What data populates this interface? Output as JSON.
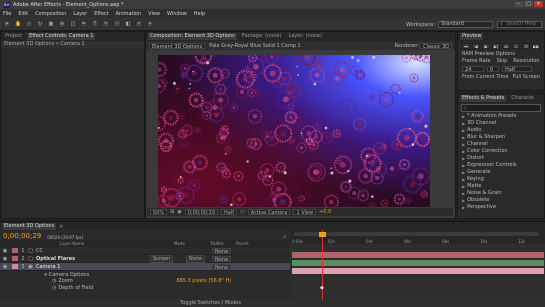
{
  "app": {
    "title": "Adobe After Effects - Element_Options.aep *",
    "logo": "Ae",
    "window_controls": [
      "–",
      "□",
      "✕"
    ]
  },
  "menu": [
    "File",
    "Edit",
    "Composition",
    "Layer",
    "Effect",
    "Animation",
    "View",
    "Window",
    "Help"
  ],
  "toolbar": {
    "tools": [
      "selection-tool-icon",
      "hand-tool-icon",
      "zoom-tool-icon",
      "rotate-tool-icon",
      "camera-tool-icon",
      "pan-behind-icon",
      "rectangle-tool-icon",
      "pen-tool-icon",
      "type-tool-icon",
      "brush-tool-icon",
      "clone-stamp-icon",
      "eraser-icon",
      "roto-brush-icon",
      "puppet-pin-icon"
    ],
    "workspace_label": "Workspace:",
    "workspace_value": "Standard",
    "search_placeholder": "Search Help"
  },
  "project": {
    "tabs": [
      "Project",
      "Effect Controls: Camera 1"
    ],
    "breadcrumb": "Element 3D Options • Camera 1"
  },
  "composition": {
    "tabs": [
      "Composition: Element 3D Options",
      "Footage: (none)",
      "Layer: (none)"
    ],
    "comp_tab": "Element 3D Options",
    "layer_path": "Pale Gray-Royal Blue Solid 1 Comp 1",
    "renderer_label": "Renderer:",
    "renderer_value": "Classic 3D",
    "bottom": {
      "zoom": "50%",
      "time": "0;00;00;29",
      "resolution": "Half",
      "view": "Active Camera",
      "views": "1 View",
      "exposure": "+0.0"
    }
  },
  "preview": {
    "title": "Preview",
    "ram_preview": "RAM Preview Options",
    "frame_rate_label": "Frame Rate",
    "skip_label": "Skip",
    "resolution_label": "Resolution",
    "frame_rate": "24",
    "skip": "0",
    "resolution": "Half",
    "from_current": "From Current Time",
    "full_screen": "Full Screen"
  },
  "effects": {
    "tabs": [
      "Effects & Presets",
      "Characte"
    ],
    "search_placeholder": "",
    "categories": [
      "* Animation Presets",
      "3D Channel",
      "Audio",
      "Blur & Sharpen",
      "Channel",
      "Color Correction",
      "Distort",
      "Expression Controls",
      "Generate",
      "Keying",
      "Matte",
      "Noise & Grain",
      "Obsolete",
      "Perspective"
    ]
  },
  "timeline": {
    "tab": "Element 3D Options",
    "timecode": "0;00;00;29",
    "fps_info": "00029 (29.97 fps)",
    "header": {
      "layer_name": "Layer Name",
      "mode": "Mode",
      "trkmat": "TrkMat",
      "parent": "Parent"
    },
    "layers": [
      {
        "index": "1",
        "name": "CC",
        "mode": "",
        "trkmat": "",
        "parent": "None"
      },
      {
        "index": "2",
        "name": "Optical Flares",
        "mode": "Screen",
        "trkmat": "None",
        "parent": "None"
      },
      {
        "index": "3",
        "name": "Camera 1",
        "mode": "",
        "trkmat": "",
        "parent": "None"
      }
    ],
    "sub": [
      "Camera Options",
      "Zoom",
      "Depth of Field"
    ],
    "zoom_value": "885.3 pixels (56.8° H)",
    "ruler": [
      "0:00s",
      "02s",
      "04s",
      "06s",
      "08s",
      "10s",
      "12s"
    ],
    "footer": "Toggle Switches / Modes"
  },
  "colors": {
    "accent": "#e8a320",
    "bar_red": "#b0636b",
    "bar_green": "#5f8a62",
    "playhead": "#e03030"
  }
}
